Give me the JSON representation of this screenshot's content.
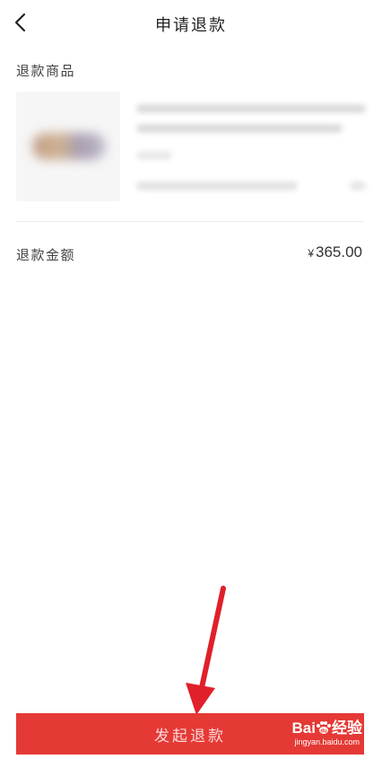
{
  "header": {
    "title": "申请退款",
    "back_icon": "chevron-left-icon"
  },
  "refund_items": {
    "label": "退款商品"
  },
  "refund_amount": {
    "label": "退款金额",
    "currency_symbol": "¥",
    "value": "365.00"
  },
  "submit": {
    "label": "发起退款"
  },
  "watermark": {
    "brand_left": "Bai",
    "brand_right": "经验",
    "url": "jingyan.baidu.com"
  },
  "colors": {
    "accent": "#e53935",
    "annotation_arrow": "#e0202a"
  }
}
